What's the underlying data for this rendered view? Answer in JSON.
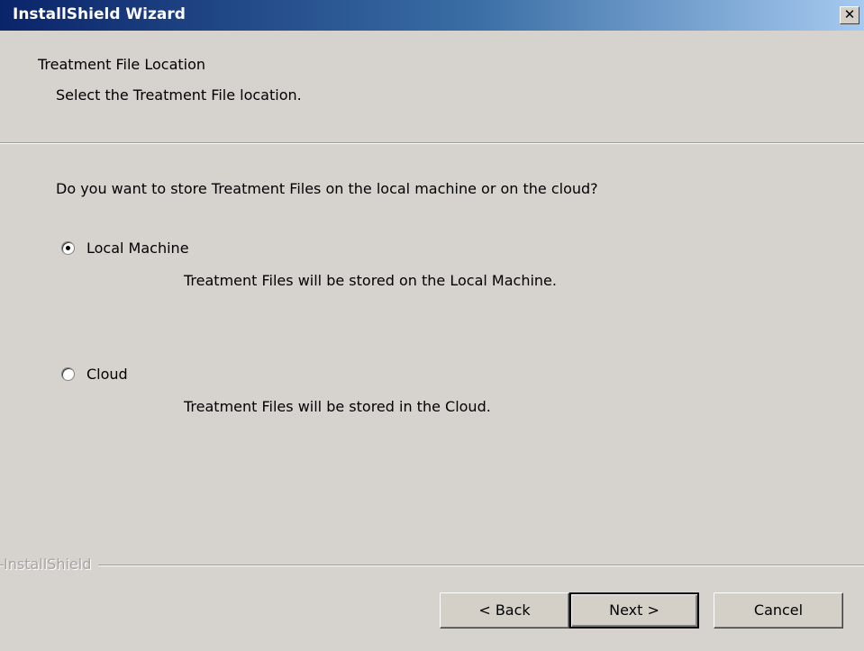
{
  "window": {
    "title": "InstallShield Wizard",
    "close_glyph": "✕"
  },
  "header": {
    "title": "Treatment File Location",
    "subtitle": "Select the Treatment File location."
  },
  "main": {
    "question": "Do you want to store Treatment Files on the local machine or on the cloud?",
    "options": [
      {
        "label": "Local Machine",
        "description": "Treatment Files will be stored on the Local Machine.",
        "selected": true
      },
      {
        "label": "Cloud",
        "description": "Treatment Files will be stored in the Cloud.",
        "selected": false
      }
    ]
  },
  "footer": {
    "brand": "InstallShield",
    "back_label": "< Back",
    "next_label": "Next >",
    "cancel_label": "Cancel"
  },
  "colors": {
    "title_gradient_start": "#0a246a",
    "title_gradient_end": "#a6caf0",
    "dialog_face": "#d6d3ce"
  }
}
